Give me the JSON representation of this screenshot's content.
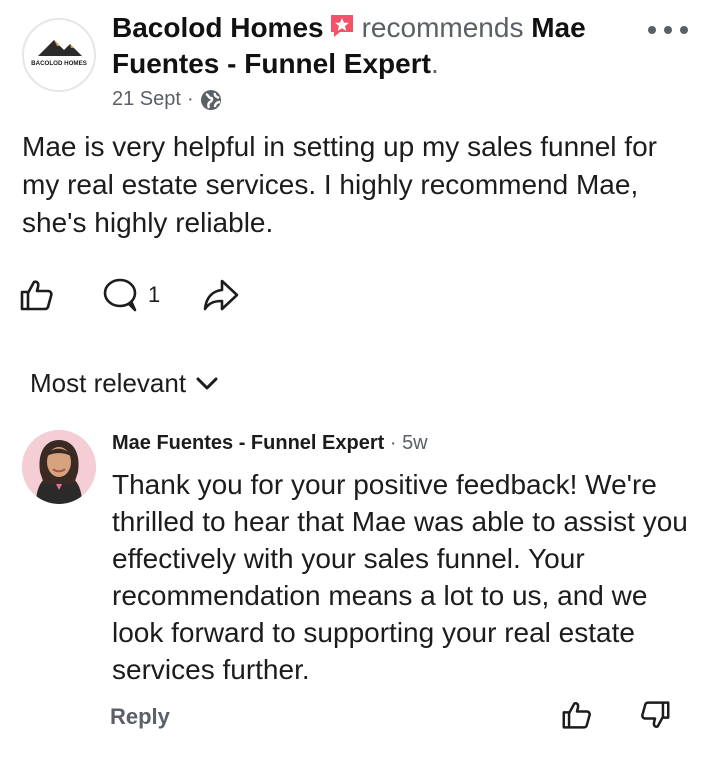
{
  "post": {
    "author": "Bacolod Homes",
    "action_text": "recommends",
    "recommended": "Mae Fuentes - Funnel Expert",
    "date": "21 Sept",
    "separator": "·",
    "body": "Mae is very helpful in setting up my sales funnel for my real estate services. I highly recommend Mae, she's highly reliable.",
    "avatar_logo_text": "BACOLOD HOMES",
    "comment_count": "1"
  },
  "comments_section": {
    "sort_label": "Most relevant"
  },
  "comment": {
    "author": "Mae Fuentes - Funnel Expert",
    "separator": "·",
    "age": "5w",
    "text": "Thank you for your positive feedback! We're thrilled to hear that Mae was able to assist you effectively with your sales funnel. Your recommendation means a lot to us, and we look forward to supporting your real estate services further.",
    "reply_label": "Reply"
  },
  "icons": {
    "recommend_badge": "star-badge-icon",
    "privacy": "globe-icon",
    "more": "more-horizontal-icon",
    "like": "thumbs-up-icon",
    "comment": "comment-bubble-icon",
    "share": "share-arrow-icon",
    "sort": "chevron-down-icon",
    "dislike": "thumbs-down-icon"
  },
  "colors": {
    "text_primary": "#1c1c1e",
    "text_secondary": "#5b5f66",
    "badge_pink": "#f35369",
    "background": "#ffffff"
  }
}
